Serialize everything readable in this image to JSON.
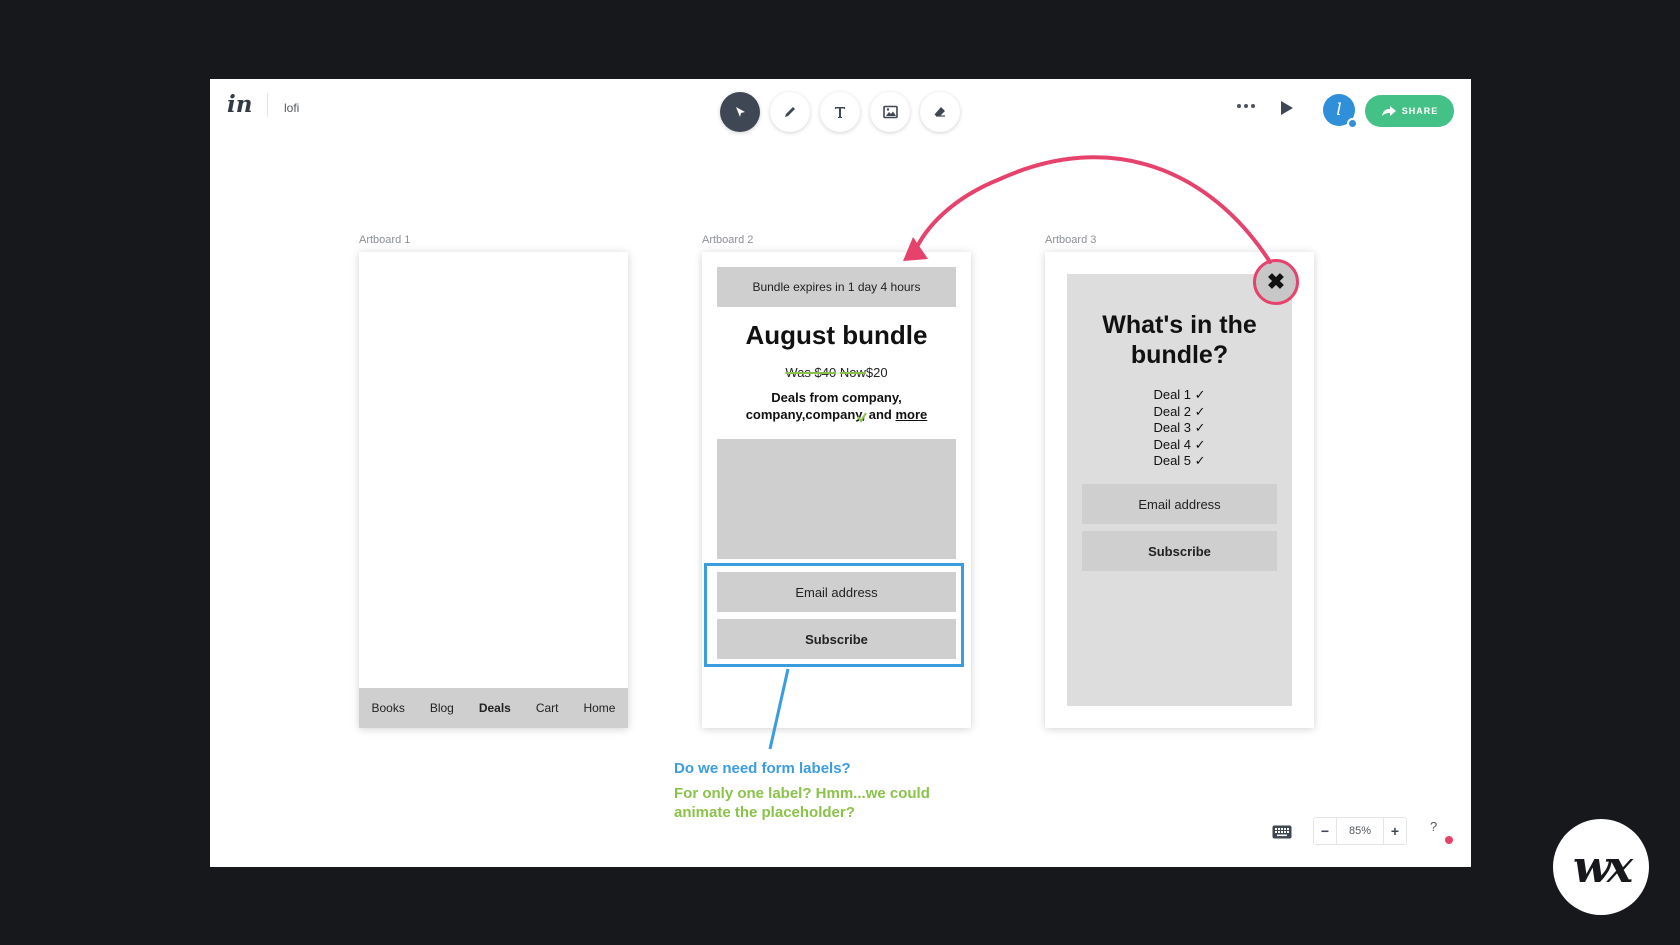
{
  "app": {
    "logo": "in",
    "doc_title": "lofi"
  },
  "toolbar": {
    "tools": [
      {
        "name": "select",
        "icon": "cursor-arrow-icon",
        "active": true
      },
      {
        "name": "pen",
        "icon": "pencil-icon",
        "active": false
      },
      {
        "name": "text",
        "icon": "text-t-icon",
        "active": false
      },
      {
        "name": "image",
        "icon": "image-icon",
        "active": false
      },
      {
        "name": "eraser",
        "icon": "eraser-icon",
        "active": false
      }
    ]
  },
  "header_right": {
    "avatar_initial": "l",
    "share_label": "SHARE"
  },
  "artboards": {
    "ab1": {
      "label": "Artboard 1",
      "nav": [
        "Books",
        "Blog",
        "Deals",
        "Cart",
        "Home"
      ],
      "nav_active": "Deals"
    },
    "ab2": {
      "label": "Artboard 2",
      "banner": "Bundle expires in 1 day 4 hours",
      "title": "August bundle",
      "price_was": "Was $40",
      "price_now_label": "Now",
      "price_now": "$20",
      "deals_text": "Deals from company, company,company, and",
      "deals_more": "more",
      "email_placeholder": "Email address",
      "subscribe_label": "Subscribe"
    },
    "ab3": {
      "label": "Artboard 3",
      "title": "What's in the bundle?",
      "deals": [
        "Deal 1 ✓",
        "Deal 2 ✓",
        "Deal 3 ✓",
        "Deal 4 ✓",
        "Deal 5 ✓"
      ],
      "email_placeholder": "Email address",
      "subscribe_label": "Subscribe",
      "close_icon": "✖"
    }
  },
  "annotations": {
    "question": "Do we need form labels?",
    "answer": "For only one label? Hmm...we could animate the placeholder?"
  },
  "zoom": {
    "minus": "−",
    "level": "85%",
    "plus": "+"
  },
  "help": "?",
  "badge": "wx",
  "colors": {
    "accent_pink": "#e6426b",
    "annotation_blue": "#3a9de0",
    "annotation_green": "#8ac24a",
    "share_green": "#44c187"
  }
}
